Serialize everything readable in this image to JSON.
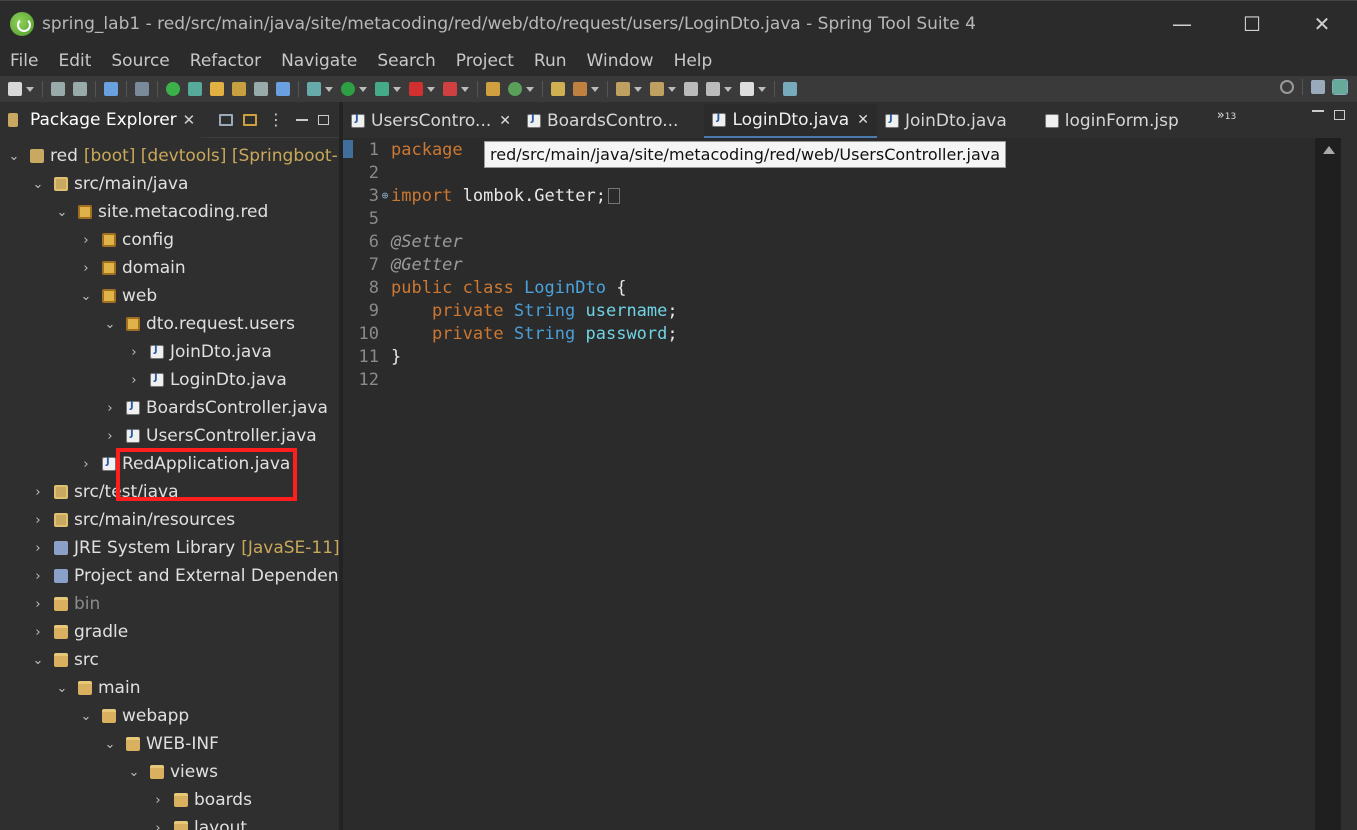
{
  "window": {
    "title": "spring_lab1 - red/src/main/java/site/metacoding/red/web/dto/request/users/LoginDto.java - Spring Tool Suite 4",
    "minimize": "—",
    "maximize": "☐",
    "close": "✕"
  },
  "menu": [
    "File",
    "Edit",
    "Source",
    "Refactor",
    "Navigate",
    "Search",
    "Project",
    "Run",
    "Window",
    "Help"
  ],
  "explorer": {
    "title": "Package Explorer",
    "close": "✕",
    "tree": [
      {
        "label": "red",
        "deco": "[boot] [devtools] [Springboot-M",
        "icon": "project-icon",
        "twisty": "⌄",
        "dim": false
      },
      {
        "label": "src/main/java",
        "icon": "source-folder-icon",
        "twisty": "⌄",
        "dim": false
      },
      {
        "label": "site.metacoding.red",
        "icon": "package-icon",
        "twisty": "⌄",
        "dim": false
      },
      {
        "label": "config",
        "icon": "package-icon",
        "twisty": "›",
        "dim": false
      },
      {
        "label": "domain",
        "icon": "package-icon",
        "twisty": "›",
        "dim": false
      },
      {
        "label": "web",
        "icon": "package-icon",
        "twisty": "⌄",
        "dim": false
      },
      {
        "label": "dto.request.users",
        "icon": "package-icon",
        "twisty": "⌄",
        "dim": false
      },
      {
        "label": "JoinDto.java",
        "icon": "java-file-icon",
        "twisty": "›",
        "dim": false
      },
      {
        "label": "LoginDto.java",
        "icon": "java-file-icon",
        "twisty": "›",
        "dim": false
      },
      {
        "label": "BoardsController.java",
        "icon": "java-file-icon",
        "twisty": "›",
        "dim": false
      },
      {
        "label": "UsersController.java",
        "icon": "java-file-icon",
        "twisty": "›",
        "dim": false
      },
      {
        "label": "RedApplication.java",
        "icon": "java-file-icon",
        "twisty": "›",
        "dim": false
      },
      {
        "label": "src/test/java",
        "icon": "source-folder-icon",
        "twisty": "›",
        "dim": false
      },
      {
        "label": "src/main/resources",
        "icon": "source-folder-icon",
        "twisty": "›",
        "dim": false
      },
      {
        "label": "JRE System Library",
        "deco": "[JavaSE-11]",
        "icon": "library-icon",
        "twisty": "›",
        "dim": false
      },
      {
        "label": "Project and External Dependenci",
        "icon": "library-icon",
        "twisty": "›",
        "dim": false
      },
      {
        "label": "bin",
        "icon": "folder-icon",
        "twisty": "›",
        "dim": true
      },
      {
        "label": "gradle",
        "icon": "folder-icon",
        "twisty": "›",
        "dim": false
      },
      {
        "label": "src",
        "icon": "folder-icon",
        "twisty": "⌄",
        "dim": false
      },
      {
        "label": "main",
        "icon": "folder-icon",
        "twisty": "⌄",
        "dim": false
      },
      {
        "label": "webapp",
        "icon": "folder-icon",
        "twisty": "⌄",
        "dim": false
      },
      {
        "label": "WEB-INF",
        "icon": "folder-icon",
        "twisty": "⌄",
        "dim": false
      },
      {
        "label": "views",
        "icon": "folder-icon",
        "twisty": "⌄",
        "dim": false
      },
      {
        "label": "boards",
        "icon": "folder-icon",
        "twisty": "›",
        "dim": false
      },
      {
        "label": "layout",
        "icon": "folder-icon",
        "twisty": "›",
        "dim": false
      }
    ]
  },
  "editor": {
    "tabs": [
      {
        "label": "UsersContro...",
        "closable": true
      },
      {
        "label": "BoardsContro...",
        "closable": false
      },
      {
        "label": "LoginDto.java",
        "closable": true,
        "active": true
      },
      {
        "label": "JoinDto.java",
        "closable": false
      },
      {
        "label": "loginForm.jsp",
        "closable": false
      }
    ],
    "overflow_chevron": "»",
    "overflow_count": "13",
    "tooltip": "red/src/main/java/site/metacoding/red/web/UsersController.java",
    "lines": [
      {
        "n": "1",
        "fold": "",
        "parts": [
          [
            "kw",
            "package "
          ]
        ]
      },
      {
        "n": "2",
        "fold": "",
        "parts": []
      },
      {
        "n": "3",
        "fold": "⊕",
        "parts": [
          [
            "kw",
            "import"
          ],
          [
            "code",
            " lombok.Getter;"
          ]
        ],
        "collapsed": true
      },
      {
        "n": "5",
        "fold": "",
        "parts": []
      },
      {
        "n": "6",
        "fold": "",
        "parts": [
          [
            "ann",
            "@Setter"
          ]
        ]
      },
      {
        "n": "7",
        "fold": "",
        "parts": [
          [
            "ann",
            "@Getter"
          ]
        ]
      },
      {
        "n": "8",
        "fold": "",
        "parts": [
          [
            "kw",
            "public class "
          ],
          [
            "cls",
            "LoginDto"
          ],
          [
            "code",
            " {"
          ]
        ]
      },
      {
        "n": "9",
        "fold": "",
        "parts": [
          [
            "code",
            "    "
          ],
          [
            "kw",
            "private "
          ],
          [
            "type",
            "String "
          ],
          [
            "fld",
            "username"
          ],
          [
            "code",
            ";"
          ]
        ]
      },
      {
        "n": "10",
        "fold": "",
        "parts": [
          [
            "code",
            "    "
          ],
          [
            "kw",
            "private "
          ],
          [
            "type",
            "String "
          ],
          [
            "fld",
            "password"
          ],
          [
            "code",
            ";"
          ]
        ]
      },
      {
        "n": "11",
        "fold": "",
        "parts": [
          [
            "code",
            "}"
          ]
        ]
      },
      {
        "n": "12",
        "fold": "",
        "parts": []
      }
    ]
  },
  "colors": {
    "keyword": "#cc7832",
    "annotation": "#9a9a9a",
    "type": "#4a9fd8",
    "field": "#6fd3e3",
    "highlight_box": "#ff1f1f"
  }
}
